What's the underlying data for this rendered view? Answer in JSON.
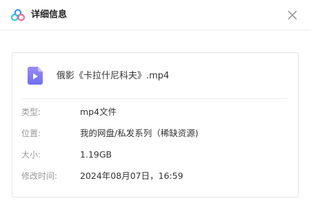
{
  "header": {
    "title": "详细信息",
    "logo_icon": "baidu-netdisk-logo-icon",
    "close_icon": "close-icon"
  },
  "file": {
    "icon": "video-file-icon",
    "icon_color": "#7e7cf5",
    "name": "俄影《卡拉什尼科夫》.mp4"
  },
  "details": {
    "type_label": "类型:",
    "type_value": "mp4文件",
    "location_label": "位置:",
    "location_value": "我的网盘/私发系列（稀缺资源)",
    "size_label": "大小:",
    "size_value": "1.19GB",
    "modified_label": "修改时间:",
    "modified_value": "2024年08月07日，16:59"
  },
  "colors": {
    "label": "#999999",
    "value": "#333333",
    "logo_blue": "#3a8ef6",
    "logo_cyan": "#35c5e8",
    "logo_pink": "#f06c8f"
  }
}
